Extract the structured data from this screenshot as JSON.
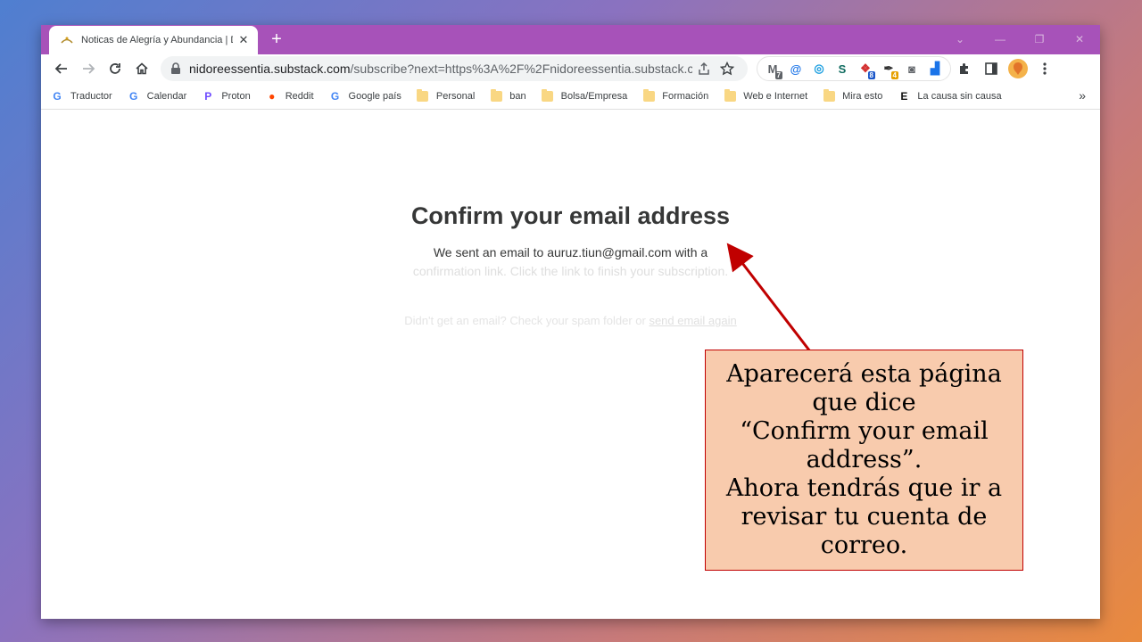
{
  "tab": {
    "title": "Noticas de Alegría y Abundancia | D",
    "close_glyph": "✕",
    "new_tab_glyph": "+"
  },
  "window_controls": {
    "dropdown": "⌄",
    "minimize": "—",
    "restore": "❐",
    "close": "✕"
  },
  "toolbar": {
    "url_host": "nidoreessentia.substack.com",
    "url_path": "/subscribe?next=https%3A%2F%2Fnidoreessentia.substack.co..."
  },
  "extensions": [
    {
      "icon": "gmail-checker-icon",
      "glyph": "M",
      "color": "#5f6368",
      "badge": "7",
      "badge_color": "#5f6368"
    },
    {
      "icon": "alarm-icon",
      "glyph": "@",
      "color": "#1a73e8",
      "badge": "",
      "badge_color": ""
    },
    {
      "icon": "circle-app-icon",
      "glyph": "◎",
      "color": "#1a9ee0",
      "badge": "",
      "badge_color": ""
    },
    {
      "icon": "sheets-s-icon",
      "glyph": "S",
      "color": "#0f6b5f",
      "badge": "",
      "badge_color": ""
    },
    {
      "icon": "red-app-icon",
      "glyph": "❖",
      "color": "#d32f2f",
      "badge": "8",
      "badge_color": "#1a56c9"
    },
    {
      "icon": "wand-icon",
      "glyph": "✒",
      "color": "#333333",
      "badge": "4",
      "badge_color": "#e6a000"
    },
    {
      "icon": "screenshot-icon",
      "glyph": "◙",
      "color": "#5f6368",
      "badge": "",
      "badge_color": ""
    },
    {
      "icon": "cleaner-icon",
      "glyph": "▟",
      "color": "#1a73e8",
      "badge": "",
      "badge_color": ""
    }
  ],
  "bookmarks": [
    {
      "label": "Traductor",
      "icon": "translate-icon",
      "kind": "icon",
      "glyph": "G",
      "color": "#4285f4"
    },
    {
      "label": "Calendar",
      "icon": "google-icon",
      "kind": "icon",
      "glyph": "G",
      "color": "#4285f4"
    },
    {
      "label": "Proton",
      "icon": "proton-icon",
      "kind": "icon",
      "glyph": "P",
      "color": "#6d4aff"
    },
    {
      "label": "Reddit",
      "icon": "reddit-icon",
      "kind": "icon",
      "glyph": "●",
      "color": "#ff4500"
    },
    {
      "label": "Google país",
      "icon": "google-icon",
      "kind": "icon",
      "glyph": "G",
      "color": "#4285f4"
    },
    {
      "label": "Personal",
      "icon": "folder-icon",
      "kind": "folder"
    },
    {
      "label": "ban",
      "icon": "folder-icon",
      "kind": "folder"
    },
    {
      "label": "Bolsa/Empresa",
      "icon": "folder-icon",
      "kind": "folder"
    },
    {
      "label": "Formación",
      "icon": "folder-icon",
      "kind": "folder"
    },
    {
      "label": "Web e Internet",
      "icon": "folder-icon",
      "kind": "folder"
    },
    {
      "label": "Mira esto",
      "icon": "folder-icon",
      "kind": "folder"
    },
    {
      "label": "La causa sin causa",
      "icon": "elpais-icon",
      "kind": "icon",
      "glyph": "E",
      "color": "#111111"
    }
  ],
  "bookmarks_more": "»",
  "page": {
    "title": "Confirm your email address",
    "body_line1": "We sent an email to auruz.tiun@gmail.com with a",
    "body_line2": "confirmation link. Click the link to finish your subscription.",
    "resend_prefix": "Didn't get an email? Check your spam folder or ",
    "resend_link": "send email again"
  },
  "callout": {
    "text": "Aparecerá esta página\nque dice\n“Confirm your email\naddress”.\nAhora tendrás que ir a\nrevisar tu cuenta de\ncorreo."
  },
  "colors": {
    "titlebar": "#a752b9",
    "callout_fill": "#f8cbad",
    "callout_border": "#c00000",
    "arrow": "#c00000"
  }
}
